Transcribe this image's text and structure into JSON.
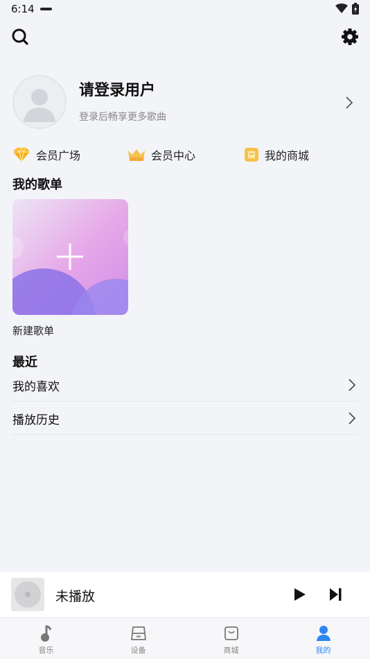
{
  "status_bar": {
    "time": "6:14"
  },
  "profile": {
    "name": "请登录用户",
    "subtitle": "登录后畅享更多歌曲"
  },
  "quick_links": [
    {
      "label": "会员广场",
      "icon": "diamond-icon",
      "color": "#f5b21b"
    },
    {
      "label": "会员中心",
      "icon": "crown-icon",
      "color": "#f7c24a"
    },
    {
      "label": "我的商城",
      "icon": "shop-icon",
      "color": "#f7c24a"
    }
  ],
  "my_playlists": {
    "title": "我的歌单",
    "new_label": "新建歌单"
  },
  "recent": {
    "title": "最近",
    "items": [
      {
        "label": "我的喜欢"
      },
      {
        "label": "播放历史"
      }
    ]
  },
  "player": {
    "title": "未播放"
  },
  "tabs": [
    {
      "label": "音乐",
      "icon": "music-note-icon",
      "active": false
    },
    {
      "label": "设备",
      "icon": "device-icon",
      "active": false
    },
    {
      "label": "商城",
      "icon": "shopping-bag-icon",
      "active": false
    },
    {
      "label": "我的",
      "icon": "person-icon",
      "active": true
    }
  ],
  "colors": {
    "accent": "#2f86f2",
    "background": "#f3f4f8"
  }
}
